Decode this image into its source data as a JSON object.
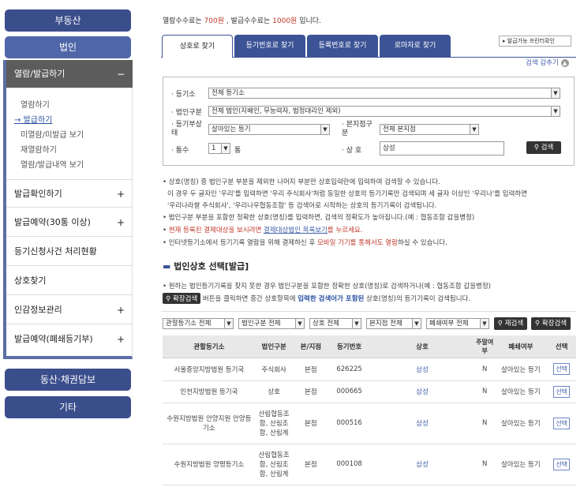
{
  "sidebar": {
    "top_button": "부동산",
    "corp_button": "법인",
    "active_section": "열람/발급하기",
    "active_section_sign": "−",
    "sub_items": [
      "열람하기",
      "발급하기",
      "미열람/미발급 보기",
      "재열람하기",
      "열람/발급내역 보기"
    ],
    "current_prefix": "→",
    "sections": [
      {
        "label": "발급확인하기",
        "sign": "+"
      },
      {
        "label": "발급예약(30통 이상)",
        "sign": "+"
      },
      {
        "label": "등기신청사건 처리현황",
        "sign": ""
      },
      {
        "label": "상호찾기",
        "sign": ""
      },
      {
        "label": "인감정보관리",
        "sign": "+"
      },
      {
        "label": "발급예약(폐쇄등기부)",
        "sign": "+"
      }
    ],
    "bottom_buttons": [
      "동산·채권담보",
      "기타"
    ]
  },
  "fee": {
    "part1": "열람수수료는 ",
    "fee1": "700원",
    "part2": " , 발급수수료는 ",
    "fee2": "1000원",
    "part3": " 입니다."
  },
  "tabs": [
    "상호로 찾기",
    "등기번호로 찾기",
    "등록번호로 찾기",
    "로마자로 찾기"
  ],
  "printer_button": "발급가능 프린터확인",
  "collapse_link": "검색 감추기",
  "collapse_icon": "chevron-up-icon",
  "form": {
    "registry_label": "등기소",
    "registry_value": "전체 등기소",
    "corp_type_label": "법인구분",
    "corp_type_value": "전체 법인(지배인, 무능력자, 법정대리인 제외)",
    "status_label": "등기부상태",
    "status_value": "살아있는 등기",
    "branch_label": "본지점구분",
    "branch_value": "전체 본지점",
    "copies_label": "통수",
    "copies_value": "1",
    "copies_unit": "통",
    "name_label": "상 호",
    "name_value": "삼성",
    "search_button": "검색"
  },
  "notes": [
    "상호(명칭) 중 법인구분 부분을 제외한 나머지 부분만 상호입력란에 입력하여 검색할 수 있습니다.",
    "이 경우 두 글자인 '우리'를 입력하면 '우리 주식회사'처럼 동일한 상호의 등기기록만 검색되며 세 글자 이상인 '우리나'를 입력하면",
    "'우리나라쌀 주식회사', '우리나우협동조합' 등 검색어로 시작하는 상호의 등기기록이 검색됩니다.",
    "법인구분 부분을 포함한 정확한 상호(명칭)를 입력하면, 검색의 정확도가 높아집니다.(예 : 협동조합 갑을병정)"
  ],
  "note_red": {
    "a": "현재 등록된 결제대상을 보시려면 ",
    "link": "결제대상법인 목록보기",
    "b": "를 누르세요."
  },
  "note_mobile": {
    "a": "인터넷등기소에서 등기기록 열람을 위해 결제하신 후 ",
    "red": "모바일 기기를 통해서도 열람",
    "b": "하실 수 있습니다."
  },
  "section_title": "법인상호 선택[발급]",
  "info1": "원하는 법인등기기록을 찾지 못한 경우 법인구분을 포함한 정확한 상호(명칭)로 검색하거나(예 : 협동조합 갑을병정)",
  "info2": {
    "button": "확장검색",
    "a": " 버튼을 클릭하면 중간 상호항목에 ",
    "blue": "입력한 검색어가 포함된",
    "b": " 상호(명칭)의 등기기록이 검색됩니다."
  },
  "filters": [
    "관할등기소 전체",
    "법인구분 전체",
    "상호 전체",
    "본지점 전체",
    "폐쇄여부 전체"
  ],
  "filter_buttons": [
    "재검색",
    "확장검색"
  ],
  "table": {
    "headers": [
      "관할등기소",
      "법인구분",
      "본/지점",
      "등기번호",
      "상호",
      "주말여부",
      "폐쇄여부",
      "선택"
    ],
    "rows": [
      [
        "서울중앙지방법원 등기국",
        "주식회사",
        "본점",
        "626225",
        "삼성",
        "N",
        "살아있는 등기",
        "선택"
      ],
      [
        "인천지방법원 등기국",
        "상호",
        "본점",
        "000665",
        "삼성",
        "N",
        "살아있는 등기",
        "선택"
      ],
      [
        "수원지방법원 안양지원 안양등기소",
        "산림협동조합, 산림조합, 산림계",
        "본점",
        "000516",
        "삼성",
        "N",
        "살아있는 등기",
        "선택"
      ],
      [
        "수원지방법원 양평등기소",
        "산림협동조합, 산림조합, 산림계",
        "본점",
        "000108",
        "삼성",
        "N",
        "살아있는 등기",
        "선택"
      ]
    ]
  }
}
